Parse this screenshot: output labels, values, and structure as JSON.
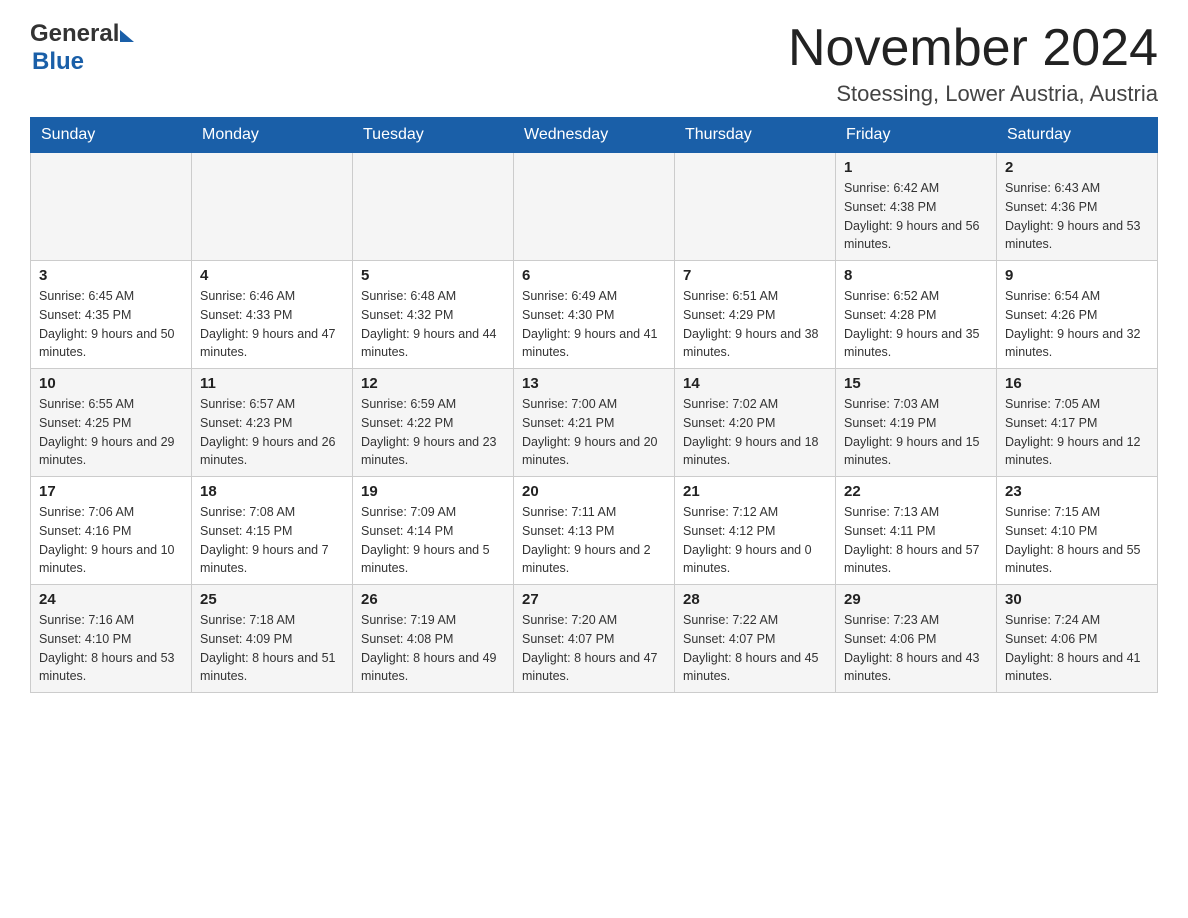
{
  "header": {
    "month_year": "November 2024",
    "location": "Stoessing, Lower Austria, Austria",
    "logo_general": "General",
    "logo_blue": "Blue"
  },
  "weekdays": [
    "Sunday",
    "Monday",
    "Tuesday",
    "Wednesday",
    "Thursday",
    "Friday",
    "Saturday"
  ],
  "weeks": [
    {
      "days": [
        {
          "number": "",
          "info": ""
        },
        {
          "number": "",
          "info": ""
        },
        {
          "number": "",
          "info": ""
        },
        {
          "number": "",
          "info": ""
        },
        {
          "number": "",
          "info": ""
        },
        {
          "number": "1",
          "info": "Sunrise: 6:42 AM\nSunset: 4:38 PM\nDaylight: 9 hours and 56 minutes."
        },
        {
          "number": "2",
          "info": "Sunrise: 6:43 AM\nSunset: 4:36 PM\nDaylight: 9 hours and 53 minutes."
        }
      ]
    },
    {
      "days": [
        {
          "number": "3",
          "info": "Sunrise: 6:45 AM\nSunset: 4:35 PM\nDaylight: 9 hours and 50 minutes."
        },
        {
          "number": "4",
          "info": "Sunrise: 6:46 AM\nSunset: 4:33 PM\nDaylight: 9 hours and 47 minutes."
        },
        {
          "number": "5",
          "info": "Sunrise: 6:48 AM\nSunset: 4:32 PM\nDaylight: 9 hours and 44 minutes."
        },
        {
          "number": "6",
          "info": "Sunrise: 6:49 AM\nSunset: 4:30 PM\nDaylight: 9 hours and 41 minutes."
        },
        {
          "number": "7",
          "info": "Sunrise: 6:51 AM\nSunset: 4:29 PM\nDaylight: 9 hours and 38 minutes."
        },
        {
          "number": "8",
          "info": "Sunrise: 6:52 AM\nSunset: 4:28 PM\nDaylight: 9 hours and 35 minutes."
        },
        {
          "number": "9",
          "info": "Sunrise: 6:54 AM\nSunset: 4:26 PM\nDaylight: 9 hours and 32 minutes."
        }
      ]
    },
    {
      "days": [
        {
          "number": "10",
          "info": "Sunrise: 6:55 AM\nSunset: 4:25 PM\nDaylight: 9 hours and 29 minutes."
        },
        {
          "number": "11",
          "info": "Sunrise: 6:57 AM\nSunset: 4:23 PM\nDaylight: 9 hours and 26 minutes."
        },
        {
          "number": "12",
          "info": "Sunrise: 6:59 AM\nSunset: 4:22 PM\nDaylight: 9 hours and 23 minutes."
        },
        {
          "number": "13",
          "info": "Sunrise: 7:00 AM\nSunset: 4:21 PM\nDaylight: 9 hours and 20 minutes."
        },
        {
          "number": "14",
          "info": "Sunrise: 7:02 AM\nSunset: 4:20 PM\nDaylight: 9 hours and 18 minutes."
        },
        {
          "number": "15",
          "info": "Sunrise: 7:03 AM\nSunset: 4:19 PM\nDaylight: 9 hours and 15 minutes."
        },
        {
          "number": "16",
          "info": "Sunrise: 7:05 AM\nSunset: 4:17 PM\nDaylight: 9 hours and 12 minutes."
        }
      ]
    },
    {
      "days": [
        {
          "number": "17",
          "info": "Sunrise: 7:06 AM\nSunset: 4:16 PM\nDaylight: 9 hours and 10 minutes."
        },
        {
          "number": "18",
          "info": "Sunrise: 7:08 AM\nSunset: 4:15 PM\nDaylight: 9 hours and 7 minutes."
        },
        {
          "number": "19",
          "info": "Sunrise: 7:09 AM\nSunset: 4:14 PM\nDaylight: 9 hours and 5 minutes."
        },
        {
          "number": "20",
          "info": "Sunrise: 7:11 AM\nSunset: 4:13 PM\nDaylight: 9 hours and 2 minutes."
        },
        {
          "number": "21",
          "info": "Sunrise: 7:12 AM\nSunset: 4:12 PM\nDaylight: 9 hours and 0 minutes."
        },
        {
          "number": "22",
          "info": "Sunrise: 7:13 AM\nSunset: 4:11 PM\nDaylight: 8 hours and 57 minutes."
        },
        {
          "number": "23",
          "info": "Sunrise: 7:15 AM\nSunset: 4:10 PM\nDaylight: 8 hours and 55 minutes."
        }
      ]
    },
    {
      "days": [
        {
          "number": "24",
          "info": "Sunrise: 7:16 AM\nSunset: 4:10 PM\nDaylight: 8 hours and 53 minutes."
        },
        {
          "number": "25",
          "info": "Sunrise: 7:18 AM\nSunset: 4:09 PM\nDaylight: 8 hours and 51 minutes."
        },
        {
          "number": "26",
          "info": "Sunrise: 7:19 AM\nSunset: 4:08 PM\nDaylight: 8 hours and 49 minutes."
        },
        {
          "number": "27",
          "info": "Sunrise: 7:20 AM\nSunset: 4:07 PM\nDaylight: 8 hours and 47 minutes."
        },
        {
          "number": "28",
          "info": "Sunrise: 7:22 AM\nSunset: 4:07 PM\nDaylight: 8 hours and 45 minutes."
        },
        {
          "number": "29",
          "info": "Sunrise: 7:23 AM\nSunset: 4:06 PM\nDaylight: 8 hours and 43 minutes."
        },
        {
          "number": "30",
          "info": "Sunrise: 7:24 AM\nSunset: 4:06 PM\nDaylight: 8 hours and 41 minutes."
        }
      ]
    }
  ]
}
